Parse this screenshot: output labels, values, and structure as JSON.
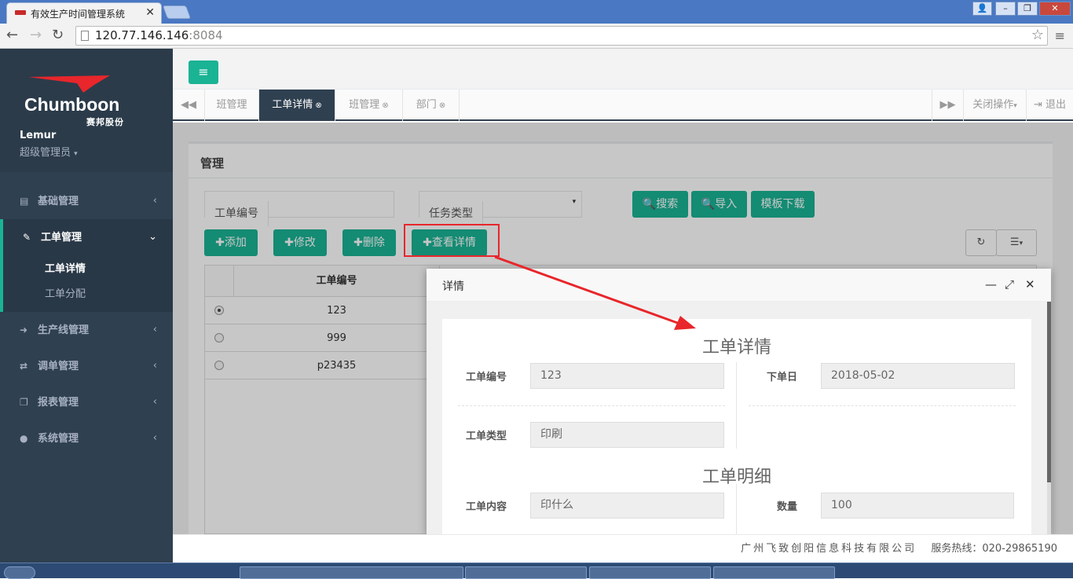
{
  "browser": {
    "tab_title": "有效生产时间管理系统",
    "url_host": "120.77.146.146",
    "url_port": ":8084"
  },
  "sidebar": {
    "brand": "Chumboon",
    "brand_sub": "赛邦股份",
    "user_name": "Lemur",
    "user_role": "超级管理员",
    "items": [
      {
        "label": "基础管理",
        "icon": "list-icon"
      },
      {
        "label": "工单管理",
        "icon": "edit-icon"
      },
      {
        "label": "生产线管理",
        "icon": "arrow-right-icon"
      },
      {
        "label": "调单管理",
        "icon": "exchange-icon"
      },
      {
        "label": "报表管理",
        "icon": "copy-icon"
      },
      {
        "label": "系统管理",
        "icon": "user-icon"
      }
    ],
    "subitems": [
      {
        "label": "工单详情"
      },
      {
        "label": "工单分配"
      }
    ]
  },
  "tabs": [
    {
      "label": "班管理"
    },
    {
      "label": "工单详情"
    },
    {
      "label": "班管理"
    },
    {
      "label": "部门"
    }
  ],
  "tab_actions": {
    "close_ops": "关闭操作",
    "logout": "退出"
  },
  "panel": {
    "title": "管理",
    "filter_order_no_label": "工单编号",
    "filter_task_type_label": "任务类型",
    "btn_search": "搜索",
    "btn_import": "导入",
    "btn_template": "模板下载",
    "btn_add": "添加",
    "btn_edit": "修改",
    "btn_delete": "删除",
    "btn_view": "查看详情"
  },
  "grid": {
    "header": "工单编号",
    "rows": [
      {
        "value": "123",
        "selected": true
      },
      {
        "value": "999",
        "selected": false
      },
      {
        "value": "p23435",
        "selected": false
      }
    ]
  },
  "dialog": {
    "title": "详情",
    "section1": "工单详情",
    "section2": "工单明细",
    "order_no_label": "工单编号",
    "order_no_value": "123",
    "order_date_label": "下单日",
    "order_date_value": "2018-05-02",
    "order_type_label": "工单类型",
    "order_type_value": "印刷",
    "content_label": "工单内容",
    "content_value": "印什么",
    "qty_label": "数量",
    "qty_value": "100"
  },
  "footer": {
    "company": "广州飞致创阳信息科技有限公司",
    "hotline": "服务热线：020-29865190"
  },
  "colors": {
    "accent": "#1ab394",
    "sidebar": "#2f4050",
    "highlight": "#e8262b"
  }
}
